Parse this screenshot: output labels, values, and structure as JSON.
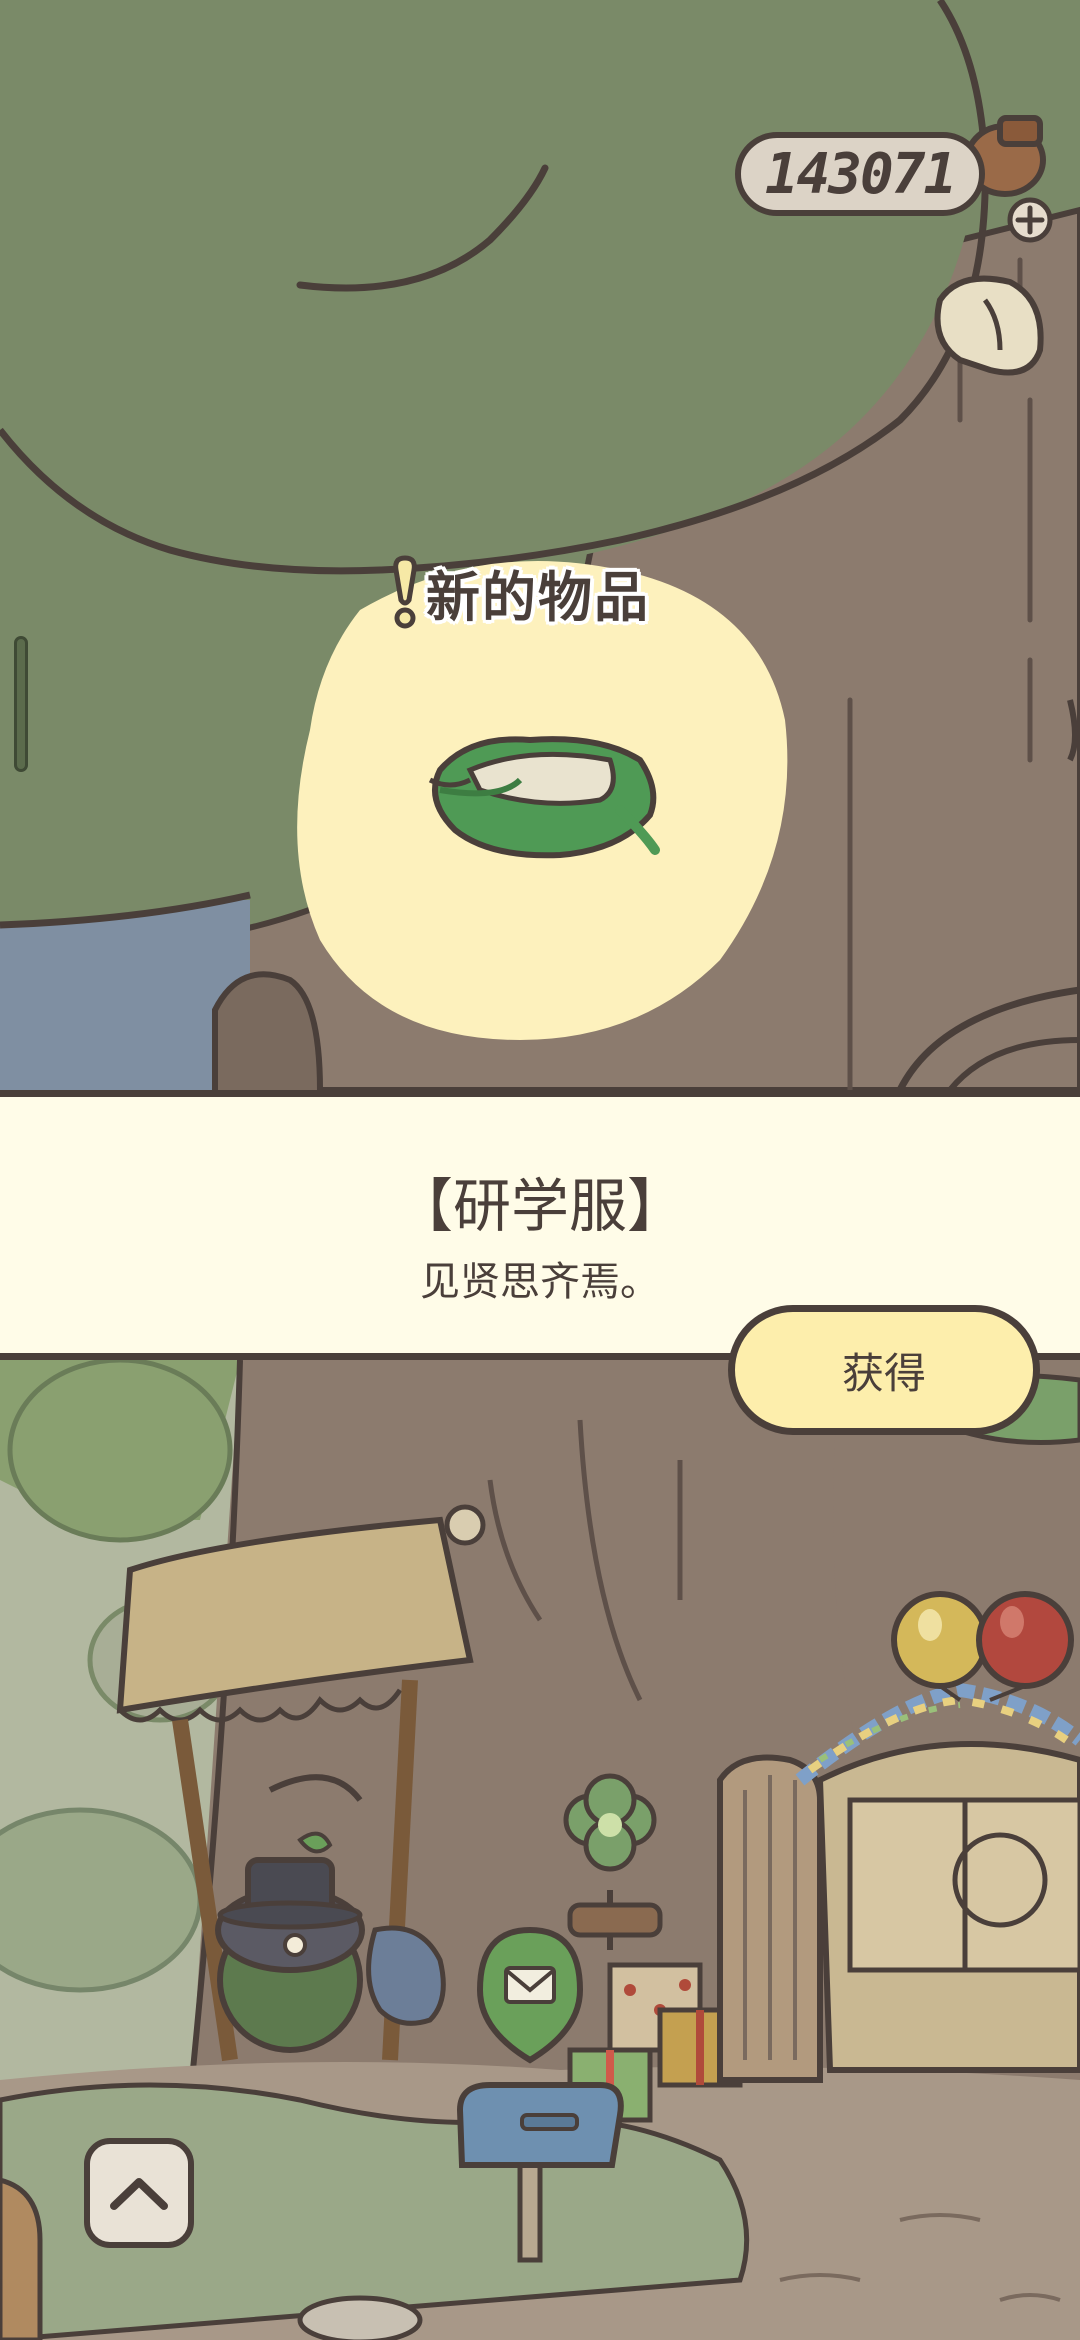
{
  "colors": {
    "outline": "#4a3f3a",
    "canopy": "#7a8a68",
    "trunk": "#8a7a6c",
    "highlight": "#fdf1bd",
    "panel": "#fffce8",
    "button": "#fdeeac",
    "item_green": "#4f9a55"
  },
  "hud": {
    "clover_count": "143071",
    "icons": [
      "clover-bag-icon",
      "plus-icon",
      "calendar-icon"
    ]
  },
  "popup": {
    "badge_label": "新的物品",
    "item_name": "【研学服】",
    "item_description": "见贤思齐焉。",
    "obtain_label": "获得",
    "item_icon": "green-scarf-outfit-icon"
  },
  "bottom_nav": {
    "up_icon": "chevron-up-icon"
  },
  "scene_icons": [
    "mail-icon",
    "mailbox-icon",
    "balloon-icon",
    "gift-icon",
    "frog-icon",
    "clover-plant-icon",
    "bag-icon"
  ]
}
